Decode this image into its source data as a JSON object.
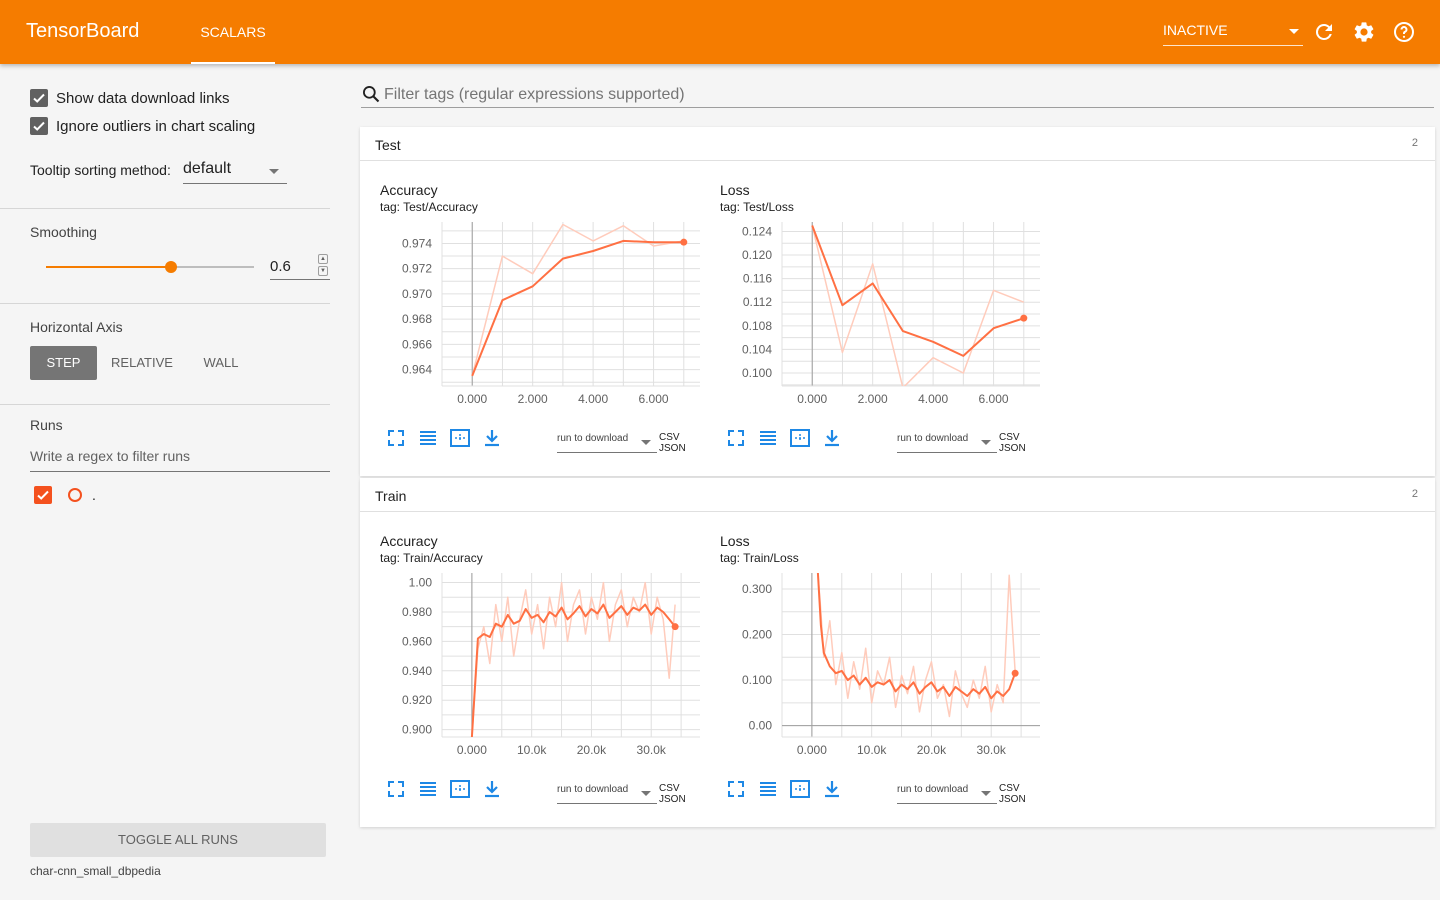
{
  "app": {
    "title": "TensorBoard",
    "tab": "SCALARS",
    "status_select": "INACTIVE",
    "icons": [
      "refresh-icon",
      "settings-gear-icon",
      "help-icon"
    ]
  },
  "sidebar": {
    "show_download_links": {
      "label": "Show data download links",
      "checked": true
    },
    "ignore_outliers": {
      "label": "Ignore outliers in chart scaling",
      "checked": true
    },
    "tooltip_sorting": {
      "label": "Tooltip sorting method:",
      "value": "default"
    },
    "smoothing": {
      "label": "Smoothing",
      "value": "0.6",
      "fraction": 0.6
    },
    "horizontal_axis": {
      "label": "Horizontal Axis",
      "options": [
        "STEP",
        "RELATIVE",
        "WALL"
      ],
      "selected": "STEP"
    },
    "runs": {
      "label": "Runs",
      "filter_placeholder": "Write a regex to filter runs",
      "items": [
        {
          "name": ".",
          "checked": true
        }
      ]
    },
    "toggle_all": "TOGGLE ALL RUNS",
    "logdir": "char-cnn_small_dbpedia"
  },
  "search": {
    "placeholder": "Filter tags (regular expressions supported)"
  },
  "categories": [
    {
      "name": "Test",
      "count": "2"
    },
    {
      "name": "Train",
      "count": "2"
    }
  ],
  "card_common": {
    "run_select": "run to download",
    "csv_json": "CSV JSON"
  },
  "colors": {
    "accent": "#f57c00",
    "line": "#ff7043",
    "line_raw": "#ffccbc"
  },
  "chart_data": [
    {
      "title": "Accuracy",
      "tag": "tag: Test/Accuracy",
      "type": "line",
      "xlim": [
        -1,
        7.9
      ],
      "ylim": [
        0.9627,
        0.9757
      ],
      "xticks": [
        0,
        2,
        4,
        6
      ],
      "xtick_labels": [
        "0.000",
        "2.000",
        "4.000",
        "6.000"
      ],
      "yticks": [
        0.964,
        0.966,
        0.968,
        0.97,
        0.972,
        0.974
      ],
      "ytick_labels": [
        "0.964",
        "0.966",
        "0.968",
        "0.970",
        "0.972",
        "0.974"
      ],
      "series": [
        {
          "x": [
            0,
            1,
            2,
            3,
            4,
            5,
            6,
            7
          ],
          "y": [
            0.9635,
            0.973,
            0.9716,
            0.9755,
            0.9742,
            0.9754,
            0.9738,
            0.9742
          ],
          "role": "raw"
        },
        {
          "x": [
            0,
            1,
            2,
            3,
            4,
            5,
            6,
            7
          ],
          "y": [
            0.9635,
            0.9695,
            0.9706,
            0.9728,
            0.9734,
            0.9742,
            0.9741,
            0.9741
          ],
          "role": "smoothed"
        }
      ]
    },
    {
      "title": "Loss",
      "tag": "tag: Test/Loss",
      "type": "line",
      "xlim": [
        -1,
        7.9
      ],
      "ylim": [
        0.0978,
        0.1256
      ],
      "xticks": [
        0,
        2,
        4,
        6
      ],
      "xtick_labels": [
        "0.000",
        "2.000",
        "4.000",
        "6.000"
      ],
      "yticks": [
        0.1,
        0.104,
        0.108,
        0.112,
        0.116,
        0.12,
        0.124
      ],
      "ytick_labels": [
        "0.100",
        "0.104",
        "0.108",
        "0.112",
        "0.116",
        "0.120",
        "0.124"
      ],
      "series": [
        {
          "x": [
            0,
            1,
            2,
            3,
            4,
            5,
            6,
            7
          ],
          "y": [
            0.125,
            0.1035,
            0.1185,
            0.0975,
            0.1026,
            0.1,
            0.114,
            0.112
          ],
          "role": "raw"
        },
        {
          "x": [
            0,
            1,
            2,
            3,
            4,
            5,
            6,
            7
          ],
          "y": [
            0.125,
            0.1115,
            0.1152,
            0.1071,
            0.1053,
            0.1029,
            0.1076,
            0.1093
          ],
          "role": "smoothed"
        }
      ]
    },
    {
      "title": "Accuracy",
      "tag": "tag: Train/Accuracy",
      "type": "line",
      "xlim": [
        -5000,
        40000
      ],
      "ylim": [
        0.895,
        1.0065
      ],
      "xticks": [
        0,
        10000,
        20000,
        30000
      ],
      "xtick_labels": [
        "0.000",
        "10.0k",
        "20.0k",
        "30.0k"
      ],
      "yticks": [
        0.9,
        0.92,
        0.94,
        0.96,
        0.98,
        1.0
      ],
      "ytick_labels": [
        "0.900",
        "0.920",
        "0.940",
        "0.960",
        "0.980",
        "1.00"
      ],
      "series": [
        {
          "x": [
            0,
            1000,
            2000,
            3000,
            4000,
            5000,
            6000,
            7000,
            8000,
            9000,
            10000,
            11000,
            12000,
            13000,
            14000,
            15000,
            16000,
            17000,
            18000,
            19000,
            20000,
            21000,
            22000,
            23000,
            24000,
            25000,
            26000,
            27000,
            28000,
            29000,
            30000,
            31000,
            32000,
            33000,
            34000
          ],
          "y": [
            0.895,
            0.955,
            0.97,
            0.945,
            0.985,
            0.96,
            0.99,
            0.95,
            0.975,
            0.995,
            0.965,
            0.985,
            0.955,
            0.99,
            0.97,
            1.0,
            0.96,
            0.985,
            0.995,
            0.965,
            0.99,
            0.975,
            1.0,
            0.96,
            0.985,
            0.995,
            0.97,
            0.99,
            0.98,
            1.0,
            0.965,
            0.99,
            0.975,
            0.935,
            0.985
          ],
          "role": "raw"
        },
        {
          "x": [
            0,
            1000,
            2000,
            3000,
            4000,
            5000,
            6000,
            7000,
            8000,
            9000,
            10000,
            11000,
            12000,
            13000,
            14000,
            15000,
            16000,
            17000,
            18000,
            19000,
            20000,
            21000,
            22000,
            23000,
            24000,
            25000,
            26000,
            27000,
            28000,
            29000,
            30000,
            31000,
            32000,
            33000,
            34000
          ],
          "y": [
            0.895,
            0.962,
            0.965,
            0.963,
            0.972,
            0.97,
            0.978,
            0.972,
            0.974,
            0.982,
            0.976,
            0.978,
            0.973,
            0.98,
            0.977,
            0.983,
            0.975,
            0.979,
            0.984,
            0.977,
            0.982,
            0.979,
            0.985,
            0.976,
            0.98,
            0.984,
            0.978,
            0.983,
            0.981,
            0.985,
            0.978,
            0.983,
            0.98,
            0.975,
            0.97
          ],
          "role": "smoothed"
        }
      ]
    },
    {
      "title": "Loss",
      "tag": "tag: Train/Loss",
      "type": "line",
      "xlim": [
        -5000,
        40000
      ],
      "ylim": [
        -0.025,
        0.335
      ],
      "xticks": [
        0,
        10000,
        20000,
        30000
      ],
      "xtick_labels": [
        "0.000",
        "10.0k",
        "20.0k",
        "30.0k"
      ],
      "yticks": [
        0.0,
        0.1,
        0.2,
        0.3
      ],
      "ytick_labels": [
        "0.00",
        "0.100",
        "0.200",
        "0.300"
      ],
      "series": [
        {
          "x": [
            1000,
            1500,
            2000,
            3000,
            4000,
            5000,
            6000,
            7000,
            8000,
            9000,
            10000,
            11000,
            12000,
            13000,
            14000,
            15000,
            16000,
            17000,
            18000,
            19000,
            20000,
            21000,
            22000,
            23000,
            24000,
            25000,
            26000,
            27000,
            28000,
            29000,
            30000,
            31000,
            32000,
            33000,
            34000
          ],
          "y": [
            0.335,
            0.25,
            0.15,
            0.23,
            0.09,
            0.16,
            0.06,
            0.14,
            0.08,
            0.17,
            0.05,
            0.12,
            0.09,
            0.15,
            0.04,
            0.11,
            0.07,
            0.13,
            0.03,
            0.1,
            0.14,
            0.06,
            0.09,
            0.02,
            0.12,
            0.07,
            0.04,
            0.1,
            0.06,
            0.13,
            0.03,
            0.09,
            0.05,
            0.33,
            0.12
          ],
          "role": "raw"
        },
        {
          "x": [
            1000,
            1500,
            2000,
            3000,
            4000,
            5000,
            6000,
            7000,
            8000,
            9000,
            10000,
            11000,
            12000,
            13000,
            14000,
            15000,
            16000,
            17000,
            18000,
            19000,
            20000,
            21000,
            22000,
            23000,
            24000,
            25000,
            26000,
            27000,
            28000,
            29000,
            30000,
            31000,
            32000,
            33000,
            34000
          ],
          "y": [
            0.335,
            0.22,
            0.16,
            0.13,
            0.115,
            0.12,
            0.1,
            0.11,
            0.09,
            0.105,
            0.085,
            0.095,
            0.09,
            0.1,
            0.075,
            0.09,
            0.08,
            0.095,
            0.07,
            0.085,
            0.095,
            0.075,
            0.085,
            0.065,
            0.085,
            0.075,
            0.065,
            0.08,
            0.07,
            0.085,
            0.06,
            0.075,
            0.065,
            0.08,
            0.115
          ],
          "role": "smoothed"
        }
      ]
    }
  ]
}
